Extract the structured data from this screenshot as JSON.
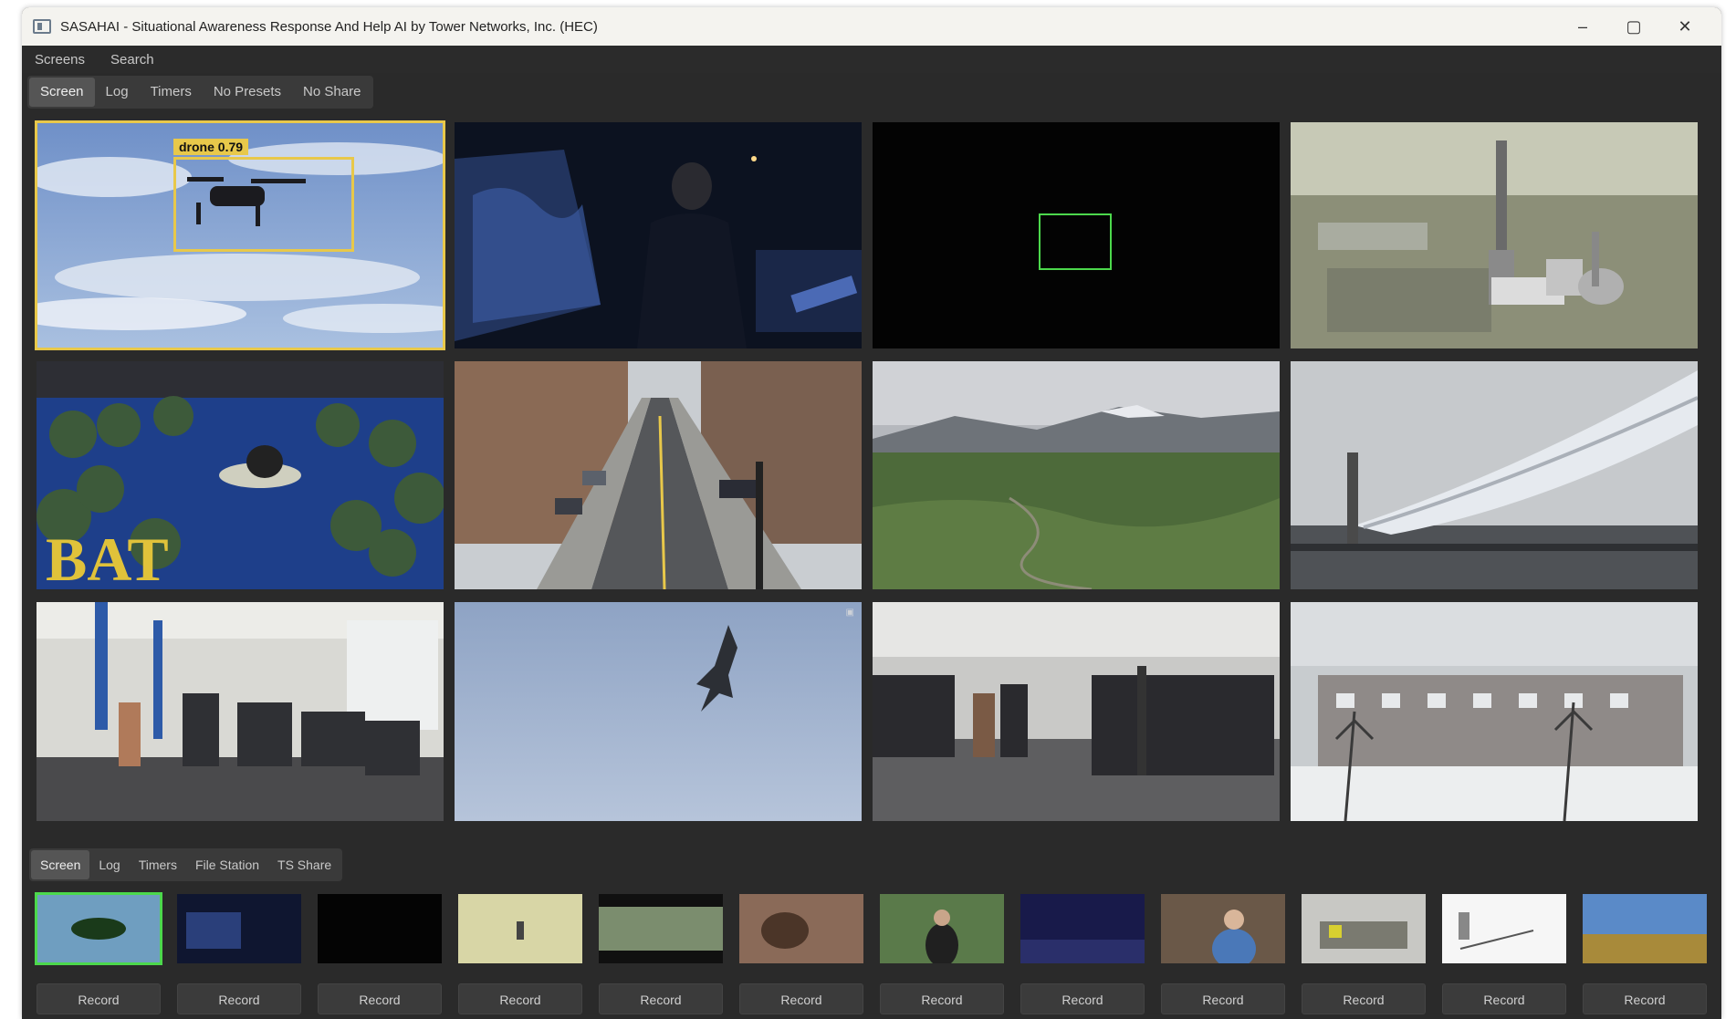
{
  "window": {
    "title": "SASAHAI - Situational Awareness Response And Help AI by Tower Networks, Inc. (HEC)",
    "controls": {
      "minimize": "–",
      "maximize": "▢",
      "close": "✕"
    }
  },
  "menu": {
    "items": [
      "Screens",
      "Search"
    ]
  },
  "tabs": {
    "items": [
      "Screen",
      "Log",
      "Timers",
      "No Presets",
      "No Share"
    ],
    "active": 0
  },
  "grid": {
    "detection": {
      "label": "drone 0.79"
    },
    "cells": [
      {
        "label": "sky-drone"
      },
      {
        "label": "night-officer"
      },
      {
        "label": "dark-feed"
      },
      {
        "label": "industrial-site"
      },
      {
        "label": "indoor-court"
      },
      {
        "label": "city-street"
      },
      {
        "label": "mountain-valley"
      },
      {
        "label": "pipeline"
      },
      {
        "label": "gym-1"
      },
      {
        "label": "jet-sky"
      },
      {
        "label": "gym-2"
      },
      {
        "label": "snowy-houses"
      }
    ]
  },
  "bottom_tabs": {
    "items": [
      "Screen",
      "Log",
      "Timers",
      "File Station",
      "TS Share"
    ],
    "active": 0
  },
  "thumbnails": {
    "count": 12
  },
  "records": {
    "label": "Record"
  },
  "colors": {
    "detection": "#e8c84a",
    "active_feed": "#4cd84c",
    "background": "#2a2a2a"
  }
}
